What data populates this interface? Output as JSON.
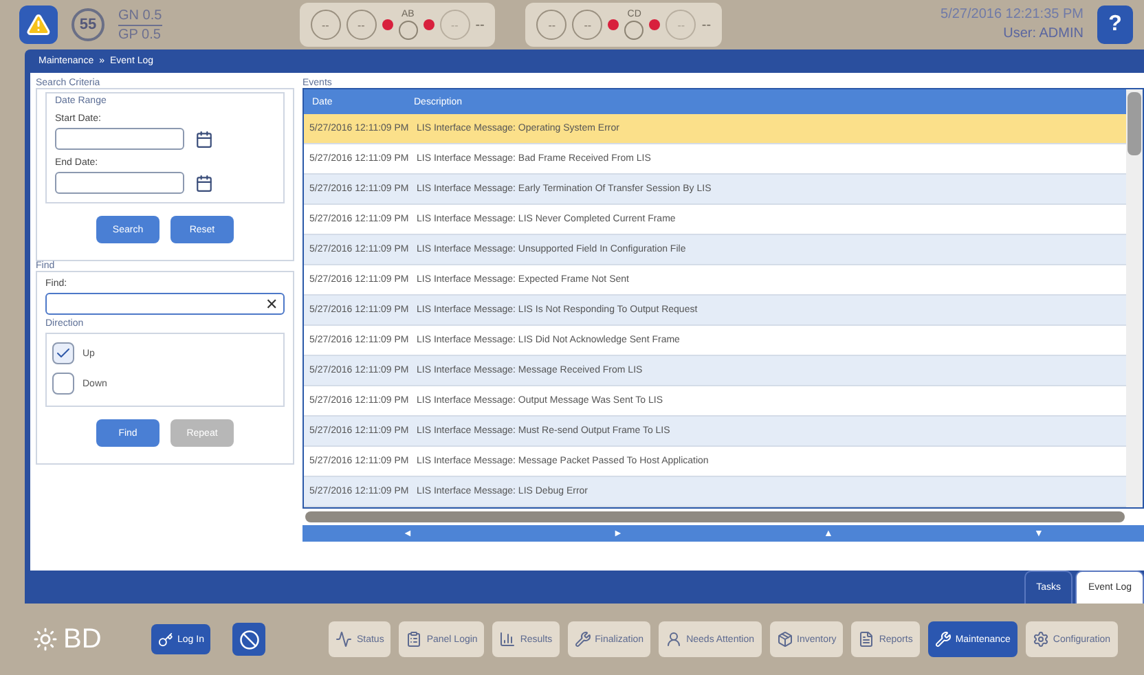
{
  "header": {
    "alert_count": "55",
    "gn": "GN 0.5",
    "gp": "GP 0.5",
    "stations": [
      {
        "label": "AB",
        "readings": [
          "--",
          "--",
          "--"
        ],
        "tail": "--"
      },
      {
        "label": "CD",
        "readings": [
          "--",
          "--",
          "--"
        ],
        "tail": "--"
      }
    ],
    "datetime": "5/27/2016 12:21:35 PM",
    "user_label": "User:",
    "user": "ADMIN",
    "help": "?"
  },
  "breadcrumb": [
    "Maintenance",
    "»",
    "Event Log"
  ],
  "search_criteria": {
    "title": "Search Criteria",
    "date_range_title": "Date Range",
    "start_label": "Start Date:",
    "end_label": "End Date:",
    "buttons": [
      "Search",
      "Reset"
    ]
  },
  "find": {
    "title": "Find",
    "label": "Find:",
    "clear": "✕",
    "direction_title": "Direction",
    "directions": [
      {
        "label": "Up",
        "checked": true
      },
      {
        "label": "Down",
        "checked": false
      }
    ],
    "buttons": [
      {
        "label": "Find",
        "disabled": false
      },
      {
        "label": "Repeat",
        "disabled": true
      }
    ]
  },
  "events": {
    "title": "Events",
    "columns": [
      "Date",
      "Description"
    ],
    "rows": [
      {
        "date": "5/27/2016 12:11:09 PM",
        "description": "LIS Interface Message: Operating System Error",
        "selected": true
      },
      {
        "date": "5/27/2016 12:11:09 PM",
        "description": "LIS Interface Message: Bad Frame Received From LIS",
        "selected": false
      },
      {
        "date": "5/27/2016 12:11:09 PM",
        "description": "LIS Interface Message: Early Termination Of Transfer Session By LIS",
        "selected": false
      },
      {
        "date": "5/27/2016 12:11:09 PM",
        "description": "LIS Interface Message: LIS Never Completed Current Frame",
        "selected": false
      },
      {
        "date": "5/27/2016 12:11:09 PM",
        "description": "LIS Interface Message: Unsupported Field In Configuration File",
        "selected": false
      },
      {
        "date": "5/27/2016 12:11:09 PM",
        "description": "LIS Interface Message: Expected Frame Not Sent",
        "selected": false
      },
      {
        "date": "5/27/2016 12:11:09 PM",
        "description": "LIS Interface Message: LIS Is Not Responding To Output Request",
        "selected": false
      },
      {
        "date": "5/27/2016 12:11:09 PM",
        "description": "LIS Interface Message: LIS Did Not Acknowledge Sent Frame",
        "selected": false
      },
      {
        "date": "5/27/2016 12:11:09 PM",
        "description": "LIS Interface Message: Message Received From LIS",
        "selected": false
      },
      {
        "date": "5/27/2016 12:11:09 PM",
        "description": "LIS Interface Message: Output Message Was Sent To LIS",
        "selected": false
      },
      {
        "date": "5/27/2016 12:11:09 PM",
        "description": "LIS Interface Message: Must Re-send Output Frame To LIS",
        "selected": false
      },
      {
        "date": "5/27/2016 12:11:09 PM",
        "description": "LIS Interface Message: Message Packet Passed To Host Application",
        "selected": false
      },
      {
        "date": "5/27/2016 12:11:09 PM",
        "description": "LIS Interface Message: LIS Debug Error",
        "selected": false
      }
    ],
    "nav_arrows": [
      "◄",
      "►",
      "▲",
      "▼"
    ]
  },
  "sub_tabs": [
    {
      "label": "Tasks",
      "selected": false
    },
    {
      "label": "Event Log",
      "selected": true
    }
  ],
  "footer": {
    "logo": "BD",
    "login": "Log In",
    "nav": [
      {
        "label": "Status",
        "selected": false
      },
      {
        "label": "Panel Login",
        "selected": false
      },
      {
        "label": "Results",
        "selected": false
      },
      {
        "label": "Finalization",
        "selected": false
      },
      {
        "label": "Needs Attention",
        "selected": false
      },
      {
        "label": "Inventory",
        "selected": false
      },
      {
        "label": "Reports",
        "selected": false
      },
      {
        "label": "Maintenance",
        "selected": true
      },
      {
        "label": "Configuration",
        "selected": false
      }
    ]
  }
}
